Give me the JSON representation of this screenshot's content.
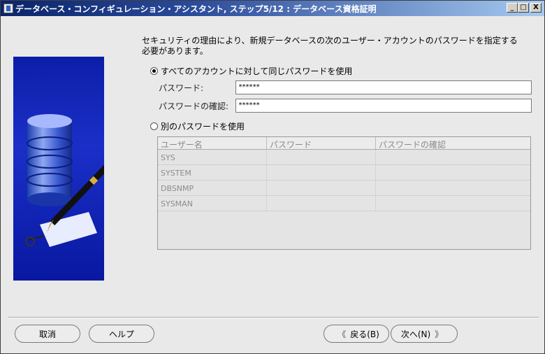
{
  "window": {
    "title": "データベース・コンフィギュレーション・アシスタント, ステップ5/12 : データベース資格証明",
    "controls": {
      "minimize": "_",
      "maximize": "□",
      "close": "X"
    }
  },
  "intro": {
    "line1": "セキュリティの理由により、新規データベースの次のユーザー・アカウントのパスワードを指定する",
    "line2": "必要があります。"
  },
  "same_password": {
    "label": "すべてのアカウントに対して同じパスワードを使用",
    "selected": true,
    "password_label": "パスワード:",
    "password_value": "******",
    "confirm_label": "パスワードの確認:",
    "confirm_value": "******"
  },
  "different_password": {
    "label": "別のパスワードを使用",
    "selected": false
  },
  "table": {
    "headers": [
      "ユーザー名",
      "パスワード",
      "パスワードの確認"
    ],
    "rows": [
      [
        "SYS",
        "",
        ""
      ],
      [
        "SYSTEM",
        "",
        ""
      ],
      [
        "DBSNMP",
        "",
        ""
      ],
      [
        "SYSMAN",
        "",
        ""
      ]
    ]
  },
  "buttons": {
    "cancel": "取消",
    "help": "ヘルプ",
    "back": "戻る(B)",
    "next": "次へ(N)"
  }
}
